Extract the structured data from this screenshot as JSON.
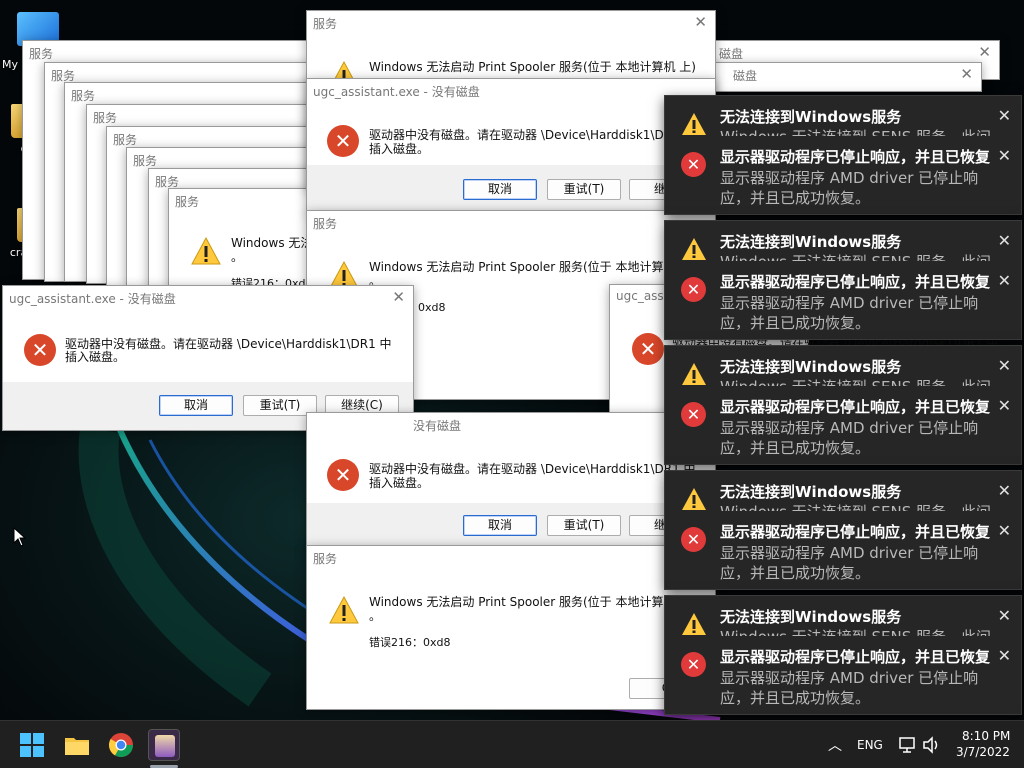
{
  "desktop": {
    "icons": [
      {
        "label": "My"
      },
      {
        "label": "craz"
      },
      {
        "label": "crazyerror"
      }
    ]
  },
  "dialog_titles": {
    "service": "服务",
    "no_disk": "ugc_assistant.exe - 没有磁盘",
    "no_disk_clipped": "没有磁盘",
    "ugc_clipped": "ugc_assist"
  },
  "messages": {
    "spooler": "Windows 无法启动 Print Spooler 服务(位于 本地计算机 上)",
    "spooler_clip1": "Windows 无法启动 Print Spooler 服务(位于 本地计算机",
    "spooler_clip2": "Windows 无法",
    "spooler_clip3": "Windows 无法启动 Print Spooler 服务(位于 本地计算机 .",
    "dot": "。",
    "error_code": "错误216：0xd8",
    "error_code_clip": "错误216：0xd",
    "error_code_short": "：0xd8",
    "disk_line1": "驱动器中没有磁盘。请在驱动器 \\Device\\Harddisk1\\DR1 中",
    "disk_line1_clip": "驱动器中没有磁盘。请在驱动器 \\Device\\Harddisk1\\DR",
    "disk_line1_clip2": "驱动器中没有磁盘。请在驱动器 \\Device\\Harddisk1\\DR1 中",
    "disk_line2": "插入磁盘。",
    "disk_line_partial": "驱动器中没有磁盘。请在驱动器 \\Device\\Harddisk1\\DR1 中"
  },
  "buttons": {
    "cancel": "取消",
    "retry": "重试(T)",
    "continue": "继续(C)",
    "continue_clip": "继续",
    "ok_clip": "C",
    "close": "✕"
  },
  "toasts": {
    "service_title": "无法连接到Windows服务",
    "service_body": "Windows 无法连接到 SENS 服务。此问",
    "driver_title": "显示器驱动程序已停止响应，并且已恢复",
    "driver_body1": "显示器驱动程序 AMD driver 已停止响",
    "driver_body2": "应，并且已成功恢复。"
  },
  "taskbar": {
    "language": "ENG",
    "time": "8:10 PM",
    "date": "3/7/2022",
    "chevron": "︿",
    "apps": [
      "start-icon",
      "file-explorer-icon",
      "chrome-icon",
      "app-icon"
    ]
  },
  "colors": {
    "error_red": "#d9472a",
    "warning_yellow": "#ffc83d",
    "toast_bg": "#262626",
    "taskbar_bg": "#202020"
  }
}
